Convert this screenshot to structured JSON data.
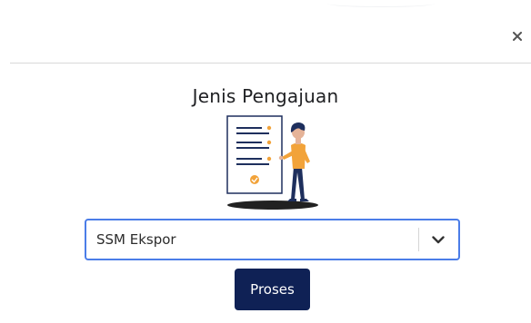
{
  "modal": {
    "title": "Jenis Pengajuan",
    "close_icon": "close-icon"
  },
  "form": {
    "request_type": {
      "selected_value": "SSM Ekspor",
      "dropdown_icon": "chevron-down-icon"
    },
    "submit_label": "Proses"
  },
  "colors": {
    "accent": "#4b7de8",
    "primary_button": "#0f2155",
    "illustration_orange": "#f2a33a",
    "illustration_navy": "#1e2f5d"
  }
}
